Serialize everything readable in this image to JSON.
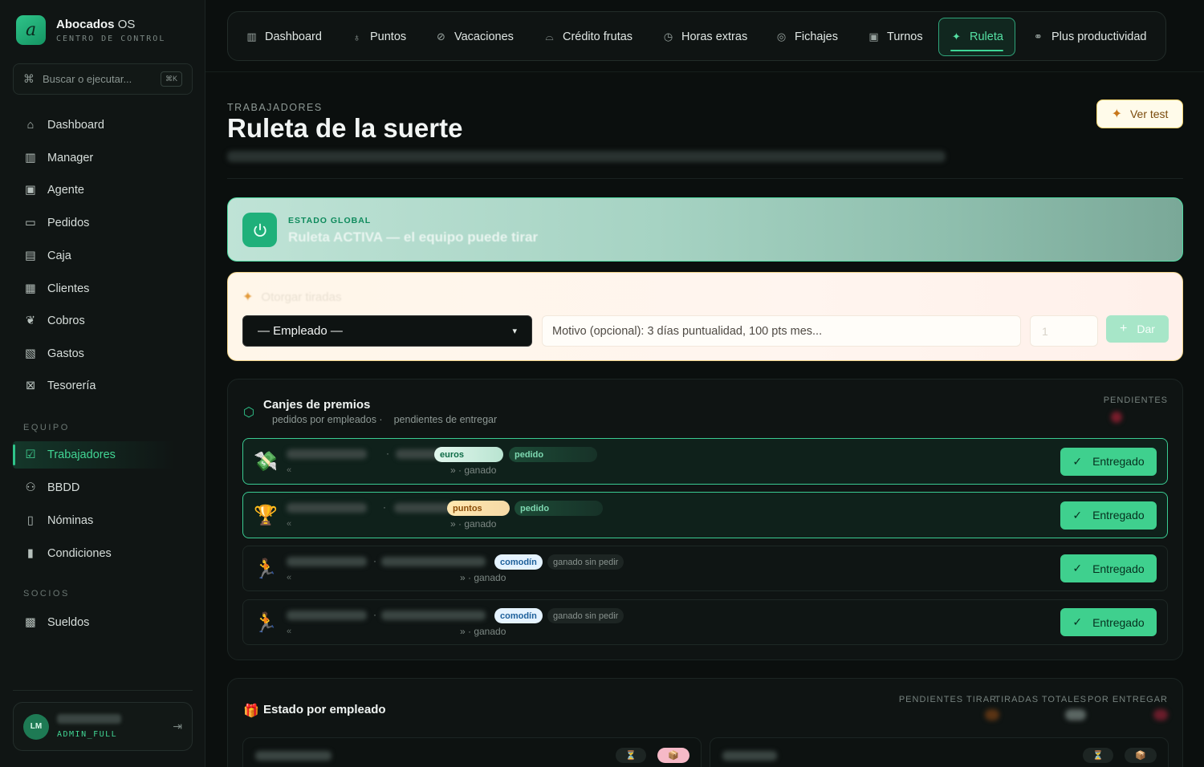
{
  "sidebar": {
    "brand_name": "Abocados",
    "brand_os": "OS",
    "brand_logo": "a",
    "brand_sub": "CENTRO DE CONTROL",
    "search_placeholder": "Buscar o ejecutar...",
    "search_shortcut": "⌘K",
    "items": [
      {
        "label": "Dashboard",
        "icon": "home-icon"
      },
      {
        "label": "Manager",
        "icon": "bar-chart-icon"
      },
      {
        "label": "Agente",
        "icon": "bot-icon"
      },
      {
        "label": "Pedidos",
        "icon": "message-icon"
      },
      {
        "label": "Caja",
        "icon": "cash-icon"
      },
      {
        "label": "Clientes",
        "icon": "contact-icon"
      },
      {
        "label": "Cobros",
        "icon": "hand-coins-icon"
      },
      {
        "label": "Gastos",
        "icon": "receipt-icon"
      },
      {
        "label": "Tesorería",
        "icon": "vault-icon"
      }
    ],
    "section_equipo": "EQUIPO",
    "equipo_items": [
      {
        "label": "Trabajadores",
        "icon": "check-square-icon",
        "active": true
      },
      {
        "label": "BBDD",
        "icon": "users-icon"
      },
      {
        "label": "Nóminas",
        "icon": "file-text-icon"
      },
      {
        "label": "Condiciones",
        "icon": "scroll-icon"
      }
    ],
    "section_socios": "SOCIOS",
    "socios_items": [
      {
        "label": "Sueldos",
        "icon": "wallet-icon"
      }
    ],
    "user": {
      "initials": "LM",
      "role": "ADMIN_FULL"
    }
  },
  "tabs": [
    {
      "label": "Dashboard",
      "icon": "bar-chart-icon"
    },
    {
      "label": "Puntos",
      "icon": "award-icon"
    },
    {
      "label": "Vacaciones",
      "icon": "calendar-off-icon"
    },
    {
      "label": "Crédito frutas",
      "icon": "basket-icon"
    },
    {
      "label": "Horas extras",
      "icon": "clock-icon"
    },
    {
      "label": "Fichajes",
      "icon": "fingerprint-icon"
    },
    {
      "label": "Turnos",
      "icon": "calendar-clock-icon"
    },
    {
      "label": "Ruleta",
      "icon": "sparkles-icon",
      "active": true
    },
    {
      "label": "Plus productividad",
      "icon": "handshake-icon"
    }
  ],
  "header": {
    "eyebrow": "TRABAJADORES",
    "title": "Ruleta de la suerte",
    "ver_test": "Ver test"
  },
  "status": {
    "label": "ESTADO GLOBAL",
    "text": "Ruleta ACTIVA — el equipo puede tirar"
  },
  "grant": {
    "title": "Otorgar tiradas",
    "employee_select": "— Empleado —",
    "reason_placeholder": "Motivo (opcional): 3 días puntualidad, 100 pts mes...",
    "count_value": "1",
    "give_button": "Dar"
  },
  "canjes": {
    "title": "Canjes de premios",
    "sub_a": "pedidos por empleados ·",
    "sub_b": "pendientes de entregar",
    "pending_label": "PENDIENTES",
    "rows": [
      {
        "emoji": "💸",
        "pill1": "euros",
        "pill2": "pedido",
        "sub_left": "«",
        "sub_mid": "» · ganado",
        "button": "Entregado",
        "highlight": true
      },
      {
        "emoji": "🏆",
        "pill1": "puntos",
        "pill2": "pedido",
        "sub_left": "«",
        "sub_mid": "» · ganado",
        "button": "Entregado",
        "highlight": true
      },
      {
        "emoji": "🏃",
        "pill1": "comodín",
        "pill2": "ganado sin pedir",
        "sub_left": "«",
        "sub_mid": "» · ganado",
        "button": "Entregado",
        "highlight": false
      },
      {
        "emoji": "🏃",
        "pill1": "comodín",
        "pill2": "ganado sin pedir",
        "sub_left": "«",
        "sub_mid": "» · ganado",
        "button": "Entregado",
        "highlight": false
      }
    ]
  },
  "estado": {
    "title": "Estado por empleado",
    "stats": [
      "PENDIENTES TIRAR",
      "TIRADAS TOTALES",
      "POR ENTREGAR"
    ],
    "mini_hourglass": "⏳",
    "mini_box": "📦"
  },
  "colors": {
    "accent": "#2fc48a",
    "background": "#0b0f0e",
    "entregado": "#3fd08e"
  }
}
